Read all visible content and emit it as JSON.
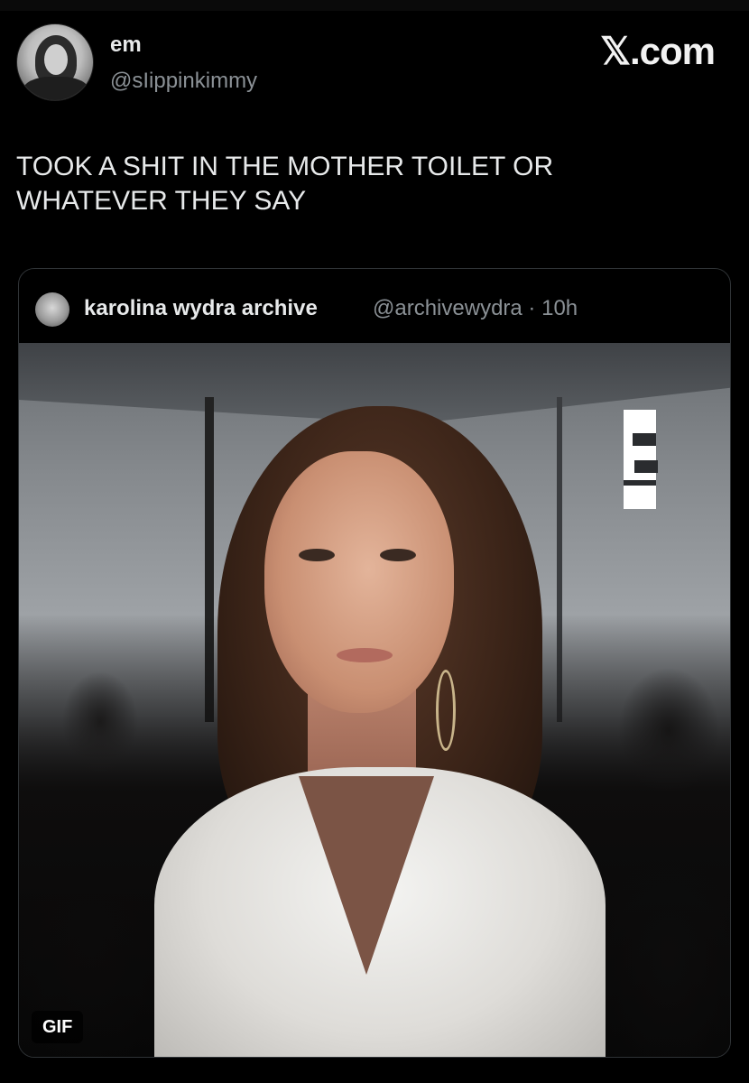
{
  "author": {
    "display_name": "em",
    "handle": "@sIippinkimmy",
    "avatar_icon": "profile-photo-icon"
  },
  "brand": {
    "label": "𝕏.com"
  },
  "tweet": {
    "text_line1": "TOOK A SHIT IN THE MOTHER TOILET OR",
    "text_line2": "WHATEVER THEY SAY"
  },
  "quoted_tweet": {
    "display_name": "karolina wydra archive",
    "handle": "@archivewydra",
    "separator": "·",
    "time": "10h",
    "media": {
      "type": "gif",
      "badge": "GIF",
      "watermark_icon": "e-news-logo-icon"
    }
  },
  "colors": {
    "background": "#000000",
    "primary_text": "#e7e9ea",
    "secondary_text": "#8b9196",
    "card_border": "#2f3336"
  }
}
